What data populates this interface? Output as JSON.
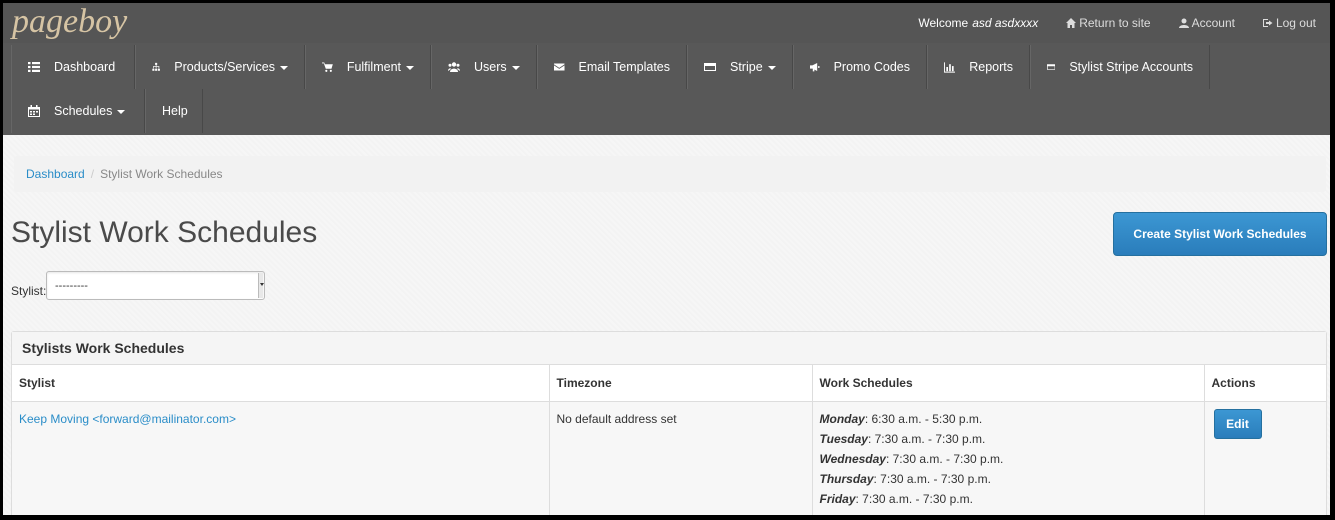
{
  "app": {
    "logo": "pageboy"
  },
  "top_links": {
    "welcome_prefix": "Welcome",
    "user_name": "asd asdxxxx",
    "return_label": "Return to site",
    "account_label": "Account",
    "logout_label": "Log out"
  },
  "nav": {
    "items": [
      {
        "label": "Dashboard",
        "icon": "list-icon",
        "dropdown": false
      },
      {
        "label": "Products/Services",
        "icon": "sitemap-icon",
        "dropdown": true
      },
      {
        "label": "Fulfilment",
        "icon": "cart-icon",
        "dropdown": true
      },
      {
        "label": "Users",
        "icon": "users-icon",
        "dropdown": true
      },
      {
        "label": "Email Templates",
        "icon": "envelope-icon",
        "dropdown": false
      },
      {
        "label": "Stripe",
        "icon": "credit-card-icon",
        "dropdown": true
      },
      {
        "label": "Promo Codes",
        "icon": "bullhorn-icon",
        "dropdown": false
      },
      {
        "label": "Reports",
        "icon": "bar-chart-icon",
        "dropdown": false
      },
      {
        "label": "Stylist Stripe Accounts",
        "icon": "credit-card-icon",
        "dropdown": false
      },
      {
        "label": "Schedules",
        "icon": "calendar-icon",
        "dropdown": true
      },
      {
        "label": "Help",
        "icon": "",
        "dropdown": false
      }
    ]
  },
  "breadcrumb": {
    "home": "Dashboard",
    "separator": "/",
    "current": "Stylist Work Schedules"
  },
  "page": {
    "title": "Stylist Work Schedules",
    "create_button": "Create Stylist Work Schedules",
    "filter_label": "Stylist:",
    "filter_value": "---------"
  },
  "panel": {
    "title": "Stylists Work Schedules",
    "columns": [
      "Stylist",
      "Timezone",
      "Work Schedules",
      "Actions"
    ],
    "rows": [
      {
        "stylist": "Keep Moving <forward@mailinator.com>",
        "timezone": "No default address set",
        "schedules": [
          {
            "day": "Monday",
            "hours": ": 6:30 a.m. - 5:30 p.m."
          },
          {
            "day": "Tuesday",
            "hours": ": 7:30 a.m. - 7:30 p.m."
          },
          {
            "day": "Wednesday",
            "hours": ": 7:30 a.m. - 7:30 p.m."
          },
          {
            "day": "Thursday",
            "hours": ": 7:30 a.m. - 7:30 p.m."
          },
          {
            "day": "Friday",
            "hours": ": 7:30 a.m. - 7:30 p.m."
          }
        ],
        "action": "Edit"
      }
    ]
  },
  "colors": {
    "link": "#2a8dc8",
    "primary_button": "#2a7dbb",
    "nav_background": "#585858"
  }
}
